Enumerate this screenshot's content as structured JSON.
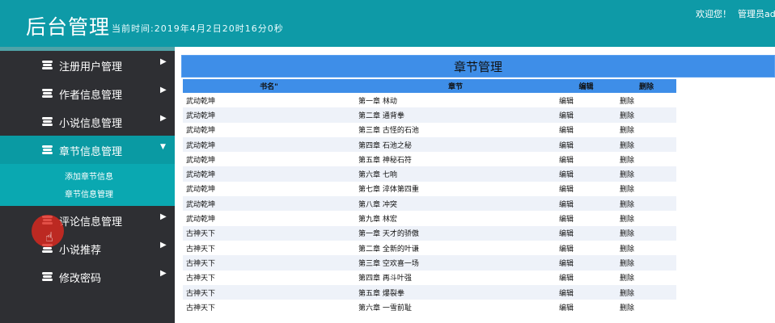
{
  "header": {
    "title": "后台管理",
    "time_label": "当前时间:",
    "time_value": "2019年4月2日20时16分0秒",
    "welcome": "欢迎您！",
    "admin": "管理员admin"
  },
  "sidebar": {
    "items": [
      {
        "label": "注册用户管理",
        "icon": "stack-icon",
        "arrow": "▶"
      },
      {
        "label": "作者信息管理",
        "icon": "stack-icon",
        "arrow": "▶"
      },
      {
        "label": "小说信息管理",
        "icon": "stack-icon",
        "arrow": "▶"
      },
      {
        "label": "章节信息管理",
        "icon": "stack-icon",
        "arrow": "▼"
      },
      {
        "label": "评论信息管理",
        "icon": "stack-icon",
        "arrow": "▶"
      },
      {
        "label": "小说推荐",
        "icon": "stack-icon",
        "arrow": "▶"
      },
      {
        "label": "修改密码",
        "icon": "stack-icon",
        "arrow": "▶"
      }
    ],
    "submenu": [
      "添加章节信息",
      "章节信息管理"
    ]
  },
  "main": {
    "panel_title": "章节管理",
    "columns": [
      "书名\"",
      "章节",
      "编辑",
      "删除"
    ],
    "rows": [
      [
        "武动乾坤",
        "第一章 林动",
        "编辑",
        "删除"
      ],
      [
        "武动乾坤",
        "第二章 通背拳",
        "编辑",
        "删除"
      ],
      [
        "武动乾坤",
        "第三章 古怪的石池",
        "编辑",
        "删除"
      ],
      [
        "武动乾坤",
        "第四章 石池之秘",
        "编辑",
        "删除"
      ],
      [
        "武动乾坤",
        "第五章 神秘石符",
        "编辑",
        "删除"
      ],
      [
        "武动乾坤",
        "第六章 七响",
        "编辑",
        "删除"
      ],
      [
        "武动乾坤",
        "第七章 淬体第四重",
        "编辑",
        "删除"
      ],
      [
        "武动乾坤",
        "第八章 冲突",
        "编辑",
        "删除"
      ],
      [
        "武动乾坤",
        "第九章 林宏",
        "编辑",
        "删除"
      ],
      [
        "古神天下",
        "第一章 天才的骄傲",
        "编辑",
        "删除"
      ],
      [
        "古神天下",
        "第二章 全新的叶谦",
        "编辑",
        "删除"
      ],
      [
        "古神天下",
        "第三章 空欢喜一场",
        "编辑",
        "删除"
      ],
      [
        "古神天下",
        "第四章 再斗叶强",
        "编辑",
        "删除"
      ],
      [
        "古神天下",
        "第五章 爆裂拳",
        "编辑",
        "删除"
      ],
      [
        "古神天下",
        "第六章 一雪前耻",
        "编辑",
        "删除"
      ]
    ]
  },
  "colors": {
    "header_bg": "#0e9aa7",
    "sidebar_bg": "#2e2f33",
    "active_bg": "#0a9aa3",
    "table_header": "#3e8ee8"
  }
}
